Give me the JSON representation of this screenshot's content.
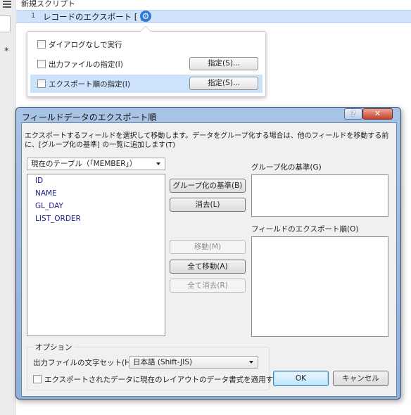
{
  "editor": {
    "script_title": "新規スクリプト",
    "step_number": "1",
    "step_text": "レコードのエクスポート [ ]",
    "marker": "*"
  },
  "popover": {
    "options": [
      {
        "label": "ダイアログなしで実行",
        "checked": false
      },
      {
        "label": "出力ファイルの指定(I)",
        "checked": false,
        "button": "指定(S)..."
      },
      {
        "label": "エクスポート順の指定(I)",
        "checked": false,
        "button": "指定(S)...",
        "selected": true
      }
    ]
  },
  "dialog": {
    "title": "フィールドデータのエクスポート順",
    "help_label": "?",
    "close_label": "✕",
    "instructions": "エクスポートするフィールドを選択して移動します。データをグループ化する場合は、他のフィールドを移動する前に、[グループ化の基準] の一覧に追加します(T)",
    "source_table": "現在のテーブル（「MEMBER」）",
    "fields": [
      "ID",
      "NAME",
      "GL_DAY",
      "LIST_ORDER"
    ],
    "buttons": {
      "group_by": "グループ化の基準(B)",
      "clear": "消去(L)",
      "move": "移動(M)",
      "move_all": "全て移動(A)",
      "clear_all": "全て消去(R)"
    },
    "group_by_label": "グループ化の基準(G)",
    "export_order_label": "フィールドのエクスポート順(O)",
    "options": {
      "title": "オプション",
      "charset_label": "出力ファイルの文字セット(H):",
      "charset_value": "日本語 (Shift-JIS)",
      "apply_format_label": "エクスポートされたデータに現在のレイアウトのデータ書式を適用する(P)",
      "apply_format_checked": false
    },
    "ok_label": "OK",
    "cancel_label": "キャンセル"
  },
  "colors": {
    "dialog_frame": "#a8c4e6",
    "selection": "#cde3fb",
    "gear_icon": "#2b79d8",
    "close_button": "#c7412c"
  }
}
